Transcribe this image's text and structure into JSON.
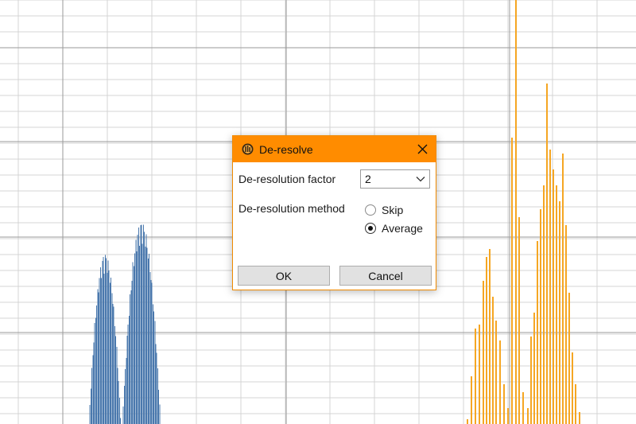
{
  "background_plot": {
    "grid_color": "#d4d4d4",
    "major_grid_color": "#9a9a9a",
    "series": [
      {
        "color": "#4a78ad"
      },
      {
        "color": "#f5a623"
      }
    ]
  },
  "dialog": {
    "title": "De-resolve",
    "title_bar_color": "#ff8c00",
    "icon": "app-icon",
    "close_icon": "close-icon",
    "factor_label": "De-resolution factor",
    "factor_value": "2",
    "method_label": "De-resolution method",
    "method_options": [
      {
        "label": "Skip",
        "selected": false
      },
      {
        "label": "Average",
        "selected": true
      }
    ],
    "ok_label": "OK",
    "cancel_label": "Cancel"
  }
}
